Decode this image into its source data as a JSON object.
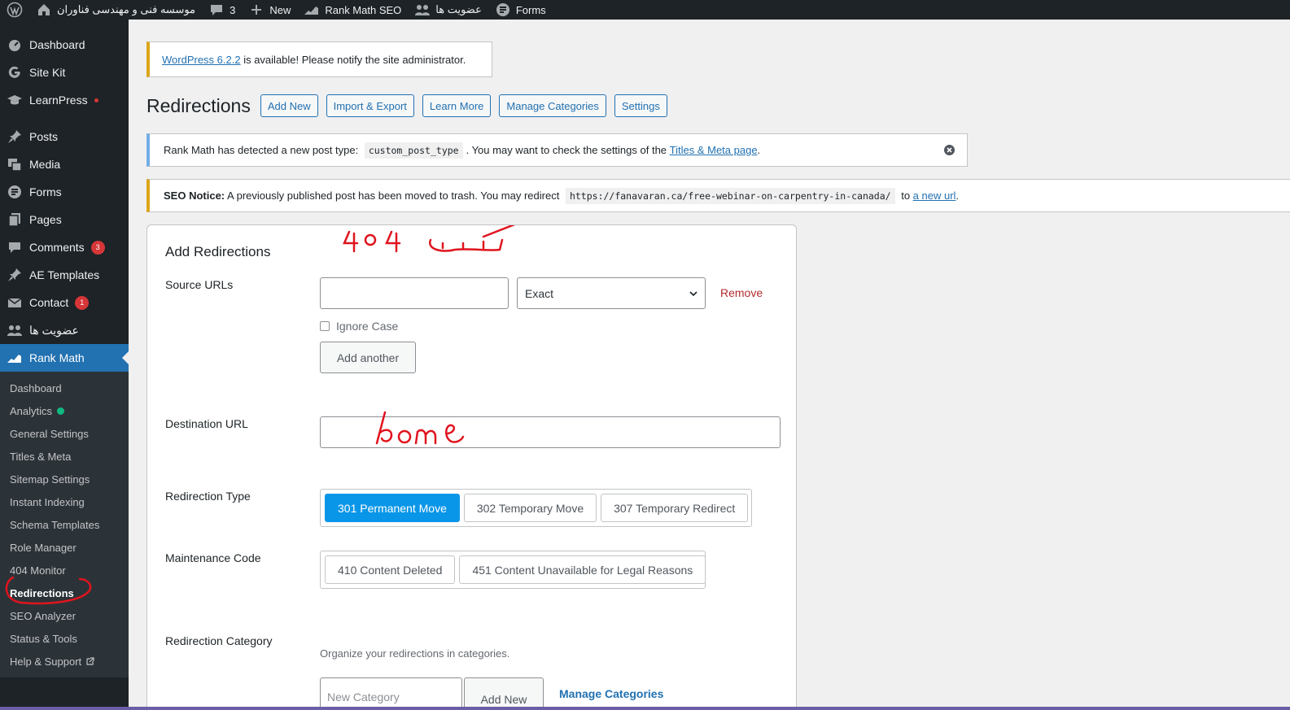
{
  "adminbar": {
    "site_name": "موسسه فنی و مهندسی فناوران",
    "comments_count": "3",
    "new_label": "New",
    "rank_math_label": "Rank Math SEO",
    "membership_label": "عضویت ها",
    "forms_label": "Forms"
  },
  "sidebar": {
    "items": [
      {
        "label": "Dashboard"
      },
      {
        "label": "Site Kit"
      },
      {
        "label": "LearnPress"
      },
      {
        "label": "Posts"
      },
      {
        "label": "Media"
      },
      {
        "label": "Forms"
      },
      {
        "label": "Pages"
      },
      {
        "label": "Comments",
        "badge": "3"
      },
      {
        "label": "AE Templates"
      },
      {
        "label": "Contact",
        "badge": "1"
      },
      {
        "label": "عضویت ها"
      },
      {
        "label": "Rank Math"
      }
    ],
    "submenu": [
      "Dashboard",
      "Analytics",
      "General Settings",
      "Titles & Meta",
      "Sitemap Settings",
      "Instant Indexing",
      "Schema Templates",
      "Role Manager",
      "404 Monitor",
      "Redirections",
      "SEO Analyzer",
      "Status & Tools",
      "Help & Support"
    ]
  },
  "update_nag": {
    "link": "WordPress 6.2.2",
    "text": " is available! Please notify the site administrator."
  },
  "page": {
    "title": "Redirections",
    "buttons": [
      "Add New",
      "Import & Export",
      "Learn More",
      "Manage Categories",
      "Settings"
    ]
  },
  "notice_info": {
    "before": "Rank Math has detected a new post type: ",
    "code": "custom_post_type",
    "middle": ". You may want to check the settings of the ",
    "link": "Titles & Meta page",
    "after": "."
  },
  "notice_seo": {
    "strong": "SEO Notice:",
    "text": " A previously published post has been moved to trash. You may redirect ",
    "code": "https://fanavaran.ca/free-webinar-on-carpentry-in-canada/",
    "to": " to ",
    "link": "a new url",
    "after": "."
  },
  "form": {
    "title": "Add Redirections",
    "source_label": "Source URLs",
    "source_value": "",
    "match_select": "Exact",
    "remove_label": "Remove",
    "ignore_case": "Ignore Case",
    "add_another": "Add another",
    "destination_label": "Destination URL",
    "destination_value": "",
    "type_label": "Redirection Type",
    "types": [
      "301 Permanent Move",
      "302 Temporary Move",
      "307 Temporary Redirect"
    ],
    "selected_type": "301 Permanent Move",
    "maintenance_label": "Maintenance Code",
    "maintenance": [
      "410 Content Deleted",
      "451 Content Unavailable for Legal Reasons"
    ],
    "category_label": "Redirection Category",
    "category_hint": "Organize your redirections in categories.",
    "category_placeholder": "New Category",
    "category_add": "Add New",
    "manage_categories": "Manage Categories"
  },
  "annotations": {
    "source_note": "404 لینک",
    "destination_note": "home"
  },
  "colors": {
    "admin_bg": "#1d2327",
    "accent": "#2271b1",
    "selected_option": "#0a96e8",
    "remove": "#b32d2e",
    "annotation": "#e0141e"
  }
}
